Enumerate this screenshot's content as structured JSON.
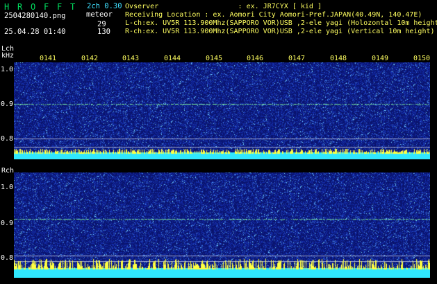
{
  "app": {
    "logo_letters": [
      "H",
      "R",
      "O",
      "F",
      "F",
      "T"
    ],
    "version": "2ch 0.30",
    "filename": "2504280140.png",
    "meteor_label": "meteor",
    "meteor_l": "29",
    "meteor_r": "130",
    "datetime": "25.04.28 01:40"
  },
  "info": {
    "observer": "Ovserver                   : ex. JR7CYX [ kid ]",
    "location": "Receiving Location : ex. Aomori City Aomori-Pref.JAPAN(40.49N, 140.47E)",
    "lch": "L-ch:ex. UV5R 113.900Mhz(SAPPORO VOR)USB ,2-ele yagi (Holozontal 10m height",
    "rch": "R-ch:ex. UV5R 113.900Mhz(SAPPORO VOR)USB ,2-ele yagi (Vertical 10m height)"
  },
  "time_ticks": [
    "0141",
    "0142",
    "0143",
    "0144",
    "0145",
    "0146",
    "0147",
    "0148",
    "0149",
    "0150"
  ],
  "lch": {
    "label": "Lch",
    "unit": "kHz",
    "y_ticks": [
      "1.0",
      "0.9",
      "0.8"
    ]
  },
  "rch": {
    "label": "Rch",
    "y_ticks": [
      "1.0",
      "0.9",
      "0.8"
    ]
  },
  "colors": {
    "background": "#000000",
    "noise": "#1a2a9a",
    "signal_line": "#7cf0a0",
    "level_bar": "#30e8ff",
    "peak": "#ffff40"
  }
}
